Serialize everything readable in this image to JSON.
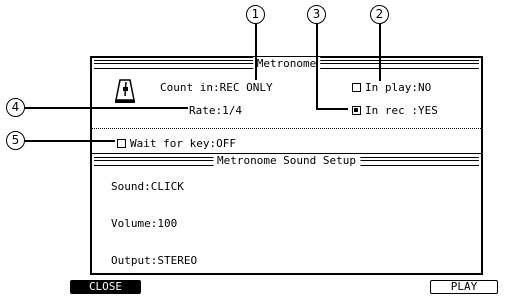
{
  "callouts": [
    "1",
    "2",
    "3",
    "4",
    "5"
  ],
  "metronome": {
    "title": "Metronome",
    "count_in": "Count in:REC ONLY",
    "rate": "Rate:1/4",
    "in_play": "In play:NO",
    "in_play_checked": false,
    "in_rec": "In rec :YES",
    "in_rec_checked": true,
    "wait_for_key": "Wait for key:OFF",
    "wait_for_key_checked": false
  },
  "sound_setup": {
    "title": "Metronome Sound Setup",
    "sound": "Sound:CLICK",
    "volume": "Volume:100",
    "output": "Output:STEREO"
  },
  "softkeys": {
    "close": "CLOSE",
    "play": "PLAY"
  },
  "icons": {
    "metronome": "metronome-icon"
  }
}
